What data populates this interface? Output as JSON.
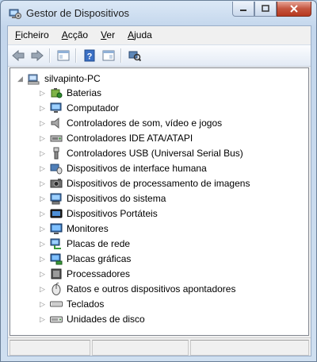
{
  "window": {
    "title": "Gestor de Dispositivos"
  },
  "menu": [
    {
      "pre": "",
      "u": "F",
      "post": "icheiro"
    },
    {
      "pre": "",
      "u": "A",
      "post": "cção"
    },
    {
      "pre": "",
      "u": "V",
      "post": "er"
    },
    {
      "pre": "",
      "u": "A",
      "post": "juda"
    }
  ],
  "tree": {
    "root": "silvapinto-PC",
    "items": [
      {
        "label": "Baterias",
        "icon": "battery-icon"
      },
      {
        "label": "Computador",
        "icon": "computer-icon"
      },
      {
        "label": "Controladores de som, vídeo e jogos",
        "icon": "speaker-icon"
      },
      {
        "label": "Controladores IDE ATA/ATAPI",
        "icon": "ide-controller-icon"
      },
      {
        "label": "Controladores USB (Universal Serial Bus)",
        "icon": "usb-icon"
      },
      {
        "label": "Dispositivos de interface humana",
        "icon": "hid-icon"
      },
      {
        "label": "Dispositivos de processamento de imagens",
        "icon": "camera-icon"
      },
      {
        "label": "Dispositivos do sistema",
        "icon": "system-devices-icon"
      },
      {
        "label": "Dispositivos Portáteis",
        "icon": "portable-device-icon"
      },
      {
        "label": "Monitores",
        "icon": "monitor-icon"
      },
      {
        "label": "Placas de rede",
        "icon": "network-adapter-icon"
      },
      {
        "label": "Placas gráficas",
        "icon": "display-adapter-icon"
      },
      {
        "label": "Processadores",
        "icon": "processor-icon"
      },
      {
        "label": "Ratos e outros dispositivos apontadores",
        "icon": "mouse-icon"
      },
      {
        "label": "Teclados",
        "icon": "keyboard-icon"
      },
      {
        "label": "Unidades de disco",
        "icon": "disk-drive-icon"
      }
    ]
  }
}
